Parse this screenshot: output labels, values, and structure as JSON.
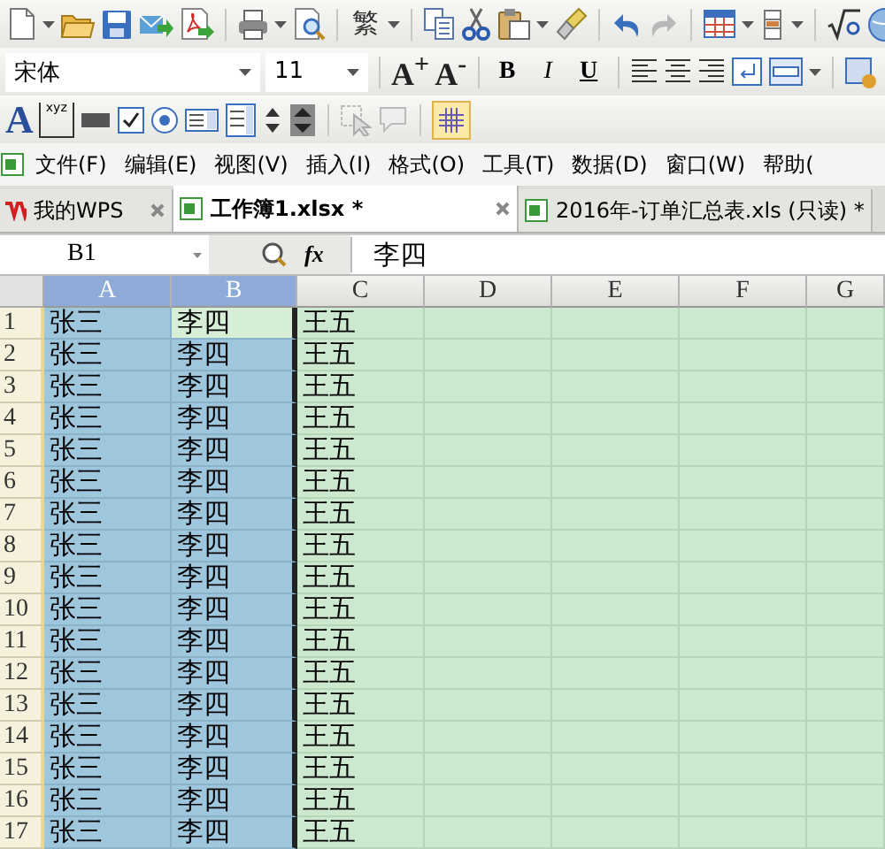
{
  "toolbar": {
    "script_button": "繁"
  },
  "format_bar": {
    "font": "宋体",
    "size": "11",
    "grow": "A$^{+}$",
    "shrink": "A$^{-}$",
    "styles": [
      "B",
      "I",
      "U"
    ]
  },
  "draw_bar": {
    "wordart": "A",
    "textbox": "xyz",
    "grid_toggle_on": true
  },
  "menu": [
    "文件(F)",
    "编辑(E)",
    "视图(V)",
    "插入(I)",
    "格式(O)",
    "工具(T)",
    "数据(D)",
    "窗口(W)",
    "帮助("
  ],
  "tabs": [
    {
      "label": "我的WPS",
      "kind": "home",
      "selected": false
    },
    {
      "label": "工作簿1.xlsx *",
      "kind": "sheet",
      "selected": true
    },
    {
      "label": "2016年-订单汇总表.xls (只读) *",
      "kind": "sheet",
      "selected": false
    }
  ],
  "formula_bar": {
    "cell": "B1",
    "function_label": "fx",
    "value": "李四"
  },
  "columns": [
    {
      "label": "A",
      "selected": true
    },
    {
      "label": "B",
      "selected": true
    },
    {
      "label": "C",
      "selected": false
    },
    {
      "label": "D",
      "selected": false
    },
    {
      "label": "E",
      "selected": false
    },
    {
      "label": "F",
      "selected": false
    },
    {
      "label": "G",
      "selected": false
    }
  ],
  "rows": [
    {
      "number": "1",
      "cells": [
        {
          "text": "张三",
          "active": false
        },
        {
          "text": "李四",
          "active": true
        },
        {
          "text": "王五",
          "active": false
        }
      ]
    },
    {
      "number": "2",
      "cells": [
        {
          "text": "张三",
          "active": false
        },
        {
          "text": "李四",
          "active": false
        },
        {
          "text": "王五",
          "active": false
        }
      ]
    },
    {
      "number": "3",
      "cells": [
        {
          "text": "张三",
          "active": false
        },
        {
          "text": "李四",
          "active": false
        },
        {
          "text": "王五",
          "active": false
        }
      ]
    },
    {
      "number": "4",
      "cells": [
        {
          "text": "张三",
          "active": false
        },
        {
          "text": "李四",
          "active": false
        },
        {
          "text": "王五",
          "active": false
        }
      ]
    },
    {
      "number": "5",
      "cells": [
        {
          "text": "张三",
          "active": false
        },
        {
          "text": "李四",
          "active": false
        },
        {
          "text": "王五",
          "active": false
        }
      ]
    },
    {
      "number": "6",
      "cells": [
        {
          "text": "张三",
          "active": false
        },
        {
          "text": "李四",
          "active": false
        },
        {
          "text": "王五",
          "active": false
        }
      ]
    },
    {
      "number": "7",
      "cells": [
        {
          "text": "张三",
          "active": false
        },
        {
          "text": "李四",
          "active": false
        },
        {
          "text": "王五",
          "active": false
        }
      ]
    },
    {
      "number": "8",
      "cells": [
        {
          "text": "张三",
          "active": false
        },
        {
          "text": "李四",
          "active": false
        },
        {
          "text": "王五",
          "active": false
        }
      ]
    },
    {
      "number": "9",
      "cells": [
        {
          "text": "张三",
          "active": false
        },
        {
          "text": "李四",
          "active": false
        },
        {
          "text": "王五",
          "active": false
        }
      ]
    },
    {
      "number": "10",
      "cells": [
        {
          "text": "张三",
          "active": false
        },
        {
          "text": "李四",
          "active": false
        },
        {
          "text": "王五",
          "active": false
        }
      ]
    },
    {
      "number": "11",
      "cells": [
        {
          "text": "张三",
          "active": false
        },
        {
          "text": "李四",
          "active": false
        },
        {
          "text": "王五",
          "active": false
        }
      ]
    },
    {
      "number": "12",
      "cells": [
        {
          "text": "张三",
          "active": false
        },
        {
          "text": "李四",
          "active": false
        },
        {
          "text": "王五",
          "active": false
        }
      ]
    },
    {
      "number": "13",
      "cells": [
        {
          "text": "张三",
          "active": false
        },
        {
          "text": "李四",
          "active": false
        },
        {
          "text": "王五",
          "active": false
        }
      ]
    },
    {
      "number": "14",
      "cells": [
        {
          "text": "张三",
          "active": false
        },
        {
          "text": "李四",
          "active": false
        },
        {
          "text": "王五",
          "active": false
        }
      ]
    },
    {
      "number": "15",
      "cells": [
        {
          "text": "张三",
          "active": false
        },
        {
          "text": "李四",
          "active": false
        },
        {
          "text": "王五",
          "active": false
        }
      ]
    },
    {
      "number": "16",
      "cells": [
        {
          "text": "张三",
          "active": false
        },
        {
          "text": "李四",
          "active": false
        },
        {
          "text": "王五",
          "active": false
        }
      ]
    },
    {
      "number": "17",
      "cells": [
        {
          "text": "张三",
          "active": false
        },
        {
          "text": "李四",
          "active": false
        },
        {
          "text": "王五",
          "active": false
        }
      ]
    }
  ]
}
